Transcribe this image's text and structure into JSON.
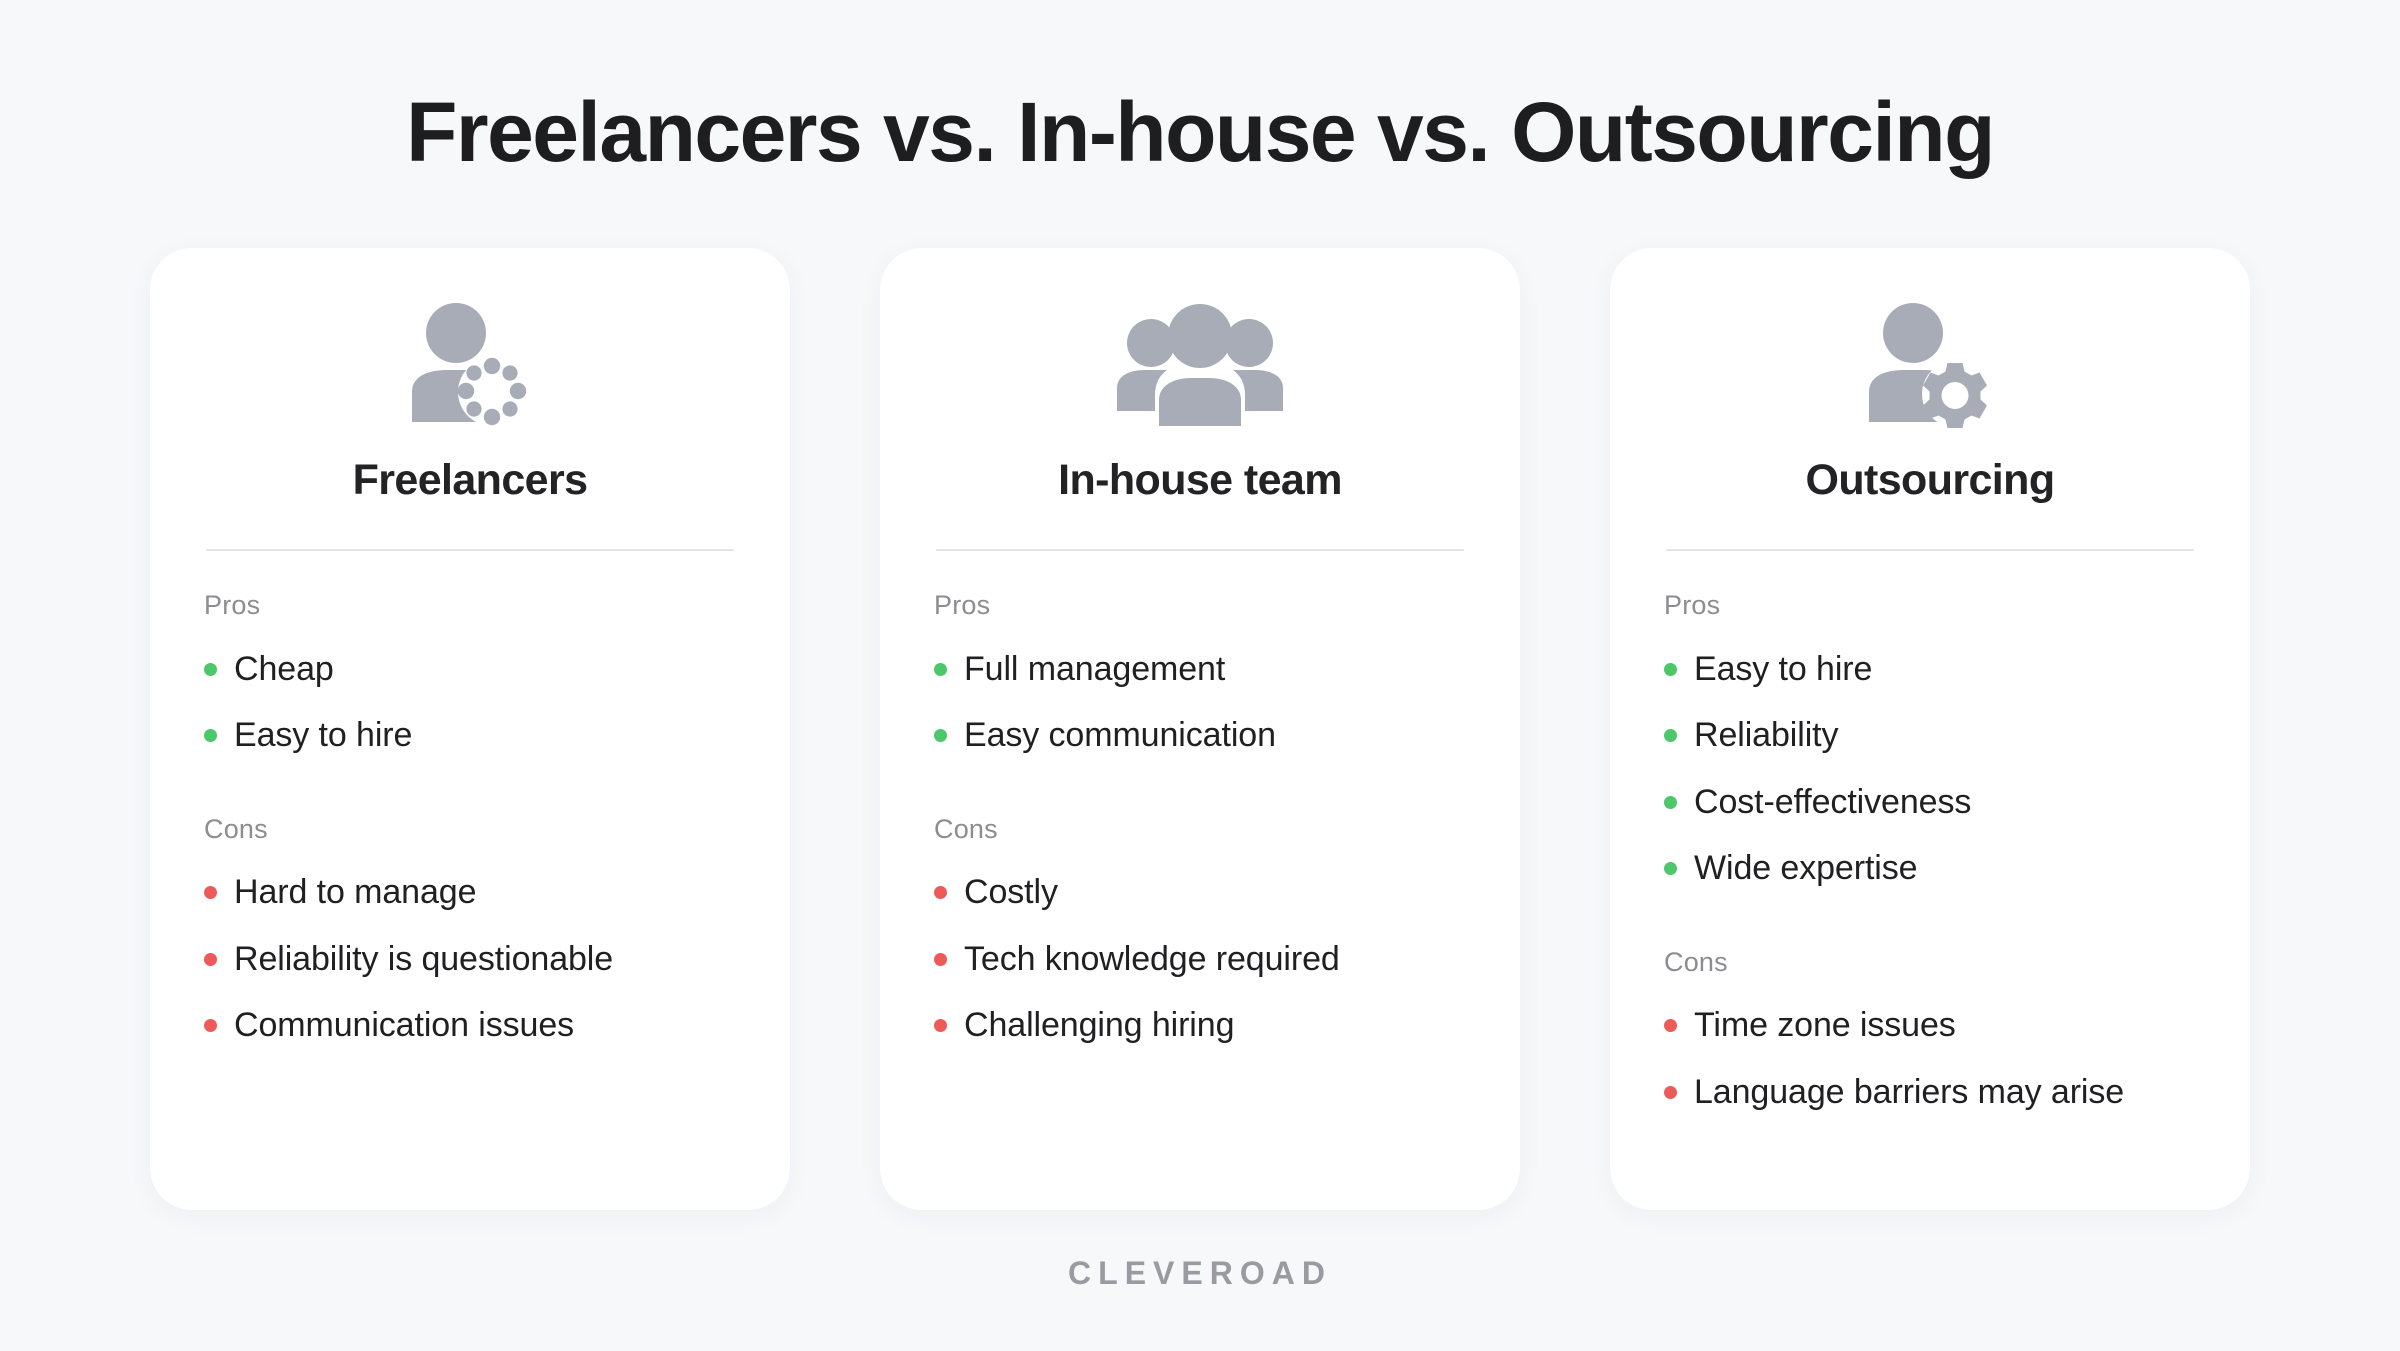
{
  "page": {
    "title": "Freelancers vs. In-house vs. Outsourcing",
    "background_color": "#F7F8FA",
    "footer_logo": "CLEVEROAD"
  },
  "labels": {
    "pros": "Pros",
    "cons": "Cons"
  },
  "colors": {
    "pro_bullet": "#4CC76A",
    "con_bullet": "#EC5A5A",
    "icon": "#A7ACB6",
    "heading": "#232326",
    "section_label": "#8C8C92",
    "divider": "#E3E4E7",
    "card_background": "#FFFFFF"
  },
  "cards": [
    {
      "icon_name": "person-spinner-icon",
      "heading": "Freelancers",
      "pros_label": "Pros",
      "cons_label": "Cons",
      "pros": [
        "Cheap",
        "Easy to hire"
      ],
      "cons": [
        "Hard to manage",
        "Reliability is questionable",
        "Communication issues"
      ]
    },
    {
      "icon_name": "people-group-icon",
      "heading": "In-house team",
      "pros_label": "Pros",
      "cons_label": "Cons",
      "pros": [
        "Full management",
        "Easy communication"
      ],
      "cons": [
        "Costly",
        "Tech knowledge required",
        "Challenging hiring"
      ]
    },
    {
      "icon_name": "person-gear-icon",
      "heading": "Outsourcing",
      "pros_label": "Pros",
      "cons_label": "Cons",
      "pros": [
        "Easy to hire",
        "Reliability",
        "Cost-effectiveness",
        "Wide expertise"
      ],
      "cons": [
        "Time zone issues",
        "Language barriers may arise"
      ]
    }
  ]
}
